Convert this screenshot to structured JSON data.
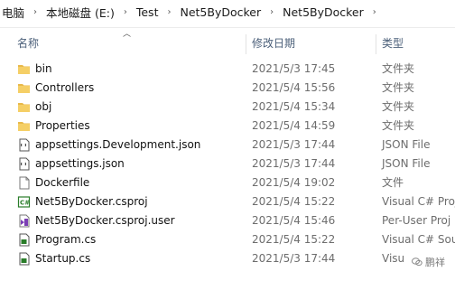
{
  "breadcrumb": {
    "items": [
      "电脑",
      "本地磁盘 (E:)",
      "Test",
      "Net5ByDocker",
      "Net5ByDocker"
    ]
  },
  "columns": {
    "name": "名称",
    "date": "修改日期",
    "type": "类型"
  },
  "rows": [
    {
      "icon": "folder-icon",
      "name": "bin",
      "date": "2021/5/3 17:45",
      "type": "文件夹"
    },
    {
      "icon": "folder-icon",
      "name": "Controllers",
      "date": "2021/5/4 15:56",
      "type": "文件夹"
    },
    {
      "icon": "folder-icon",
      "name": "obj",
      "date": "2021/5/4 15:34",
      "type": "文件夹"
    },
    {
      "icon": "folder-icon",
      "name": "Properties",
      "date": "2021/5/4 14:59",
      "type": "文件夹"
    },
    {
      "icon": "json-file-icon",
      "name": "appsettings.Development.json",
      "date": "2021/5/3 17:44",
      "type": "JSON File"
    },
    {
      "icon": "json-file-icon",
      "name": "appsettings.json",
      "date": "2021/5/3 17:44",
      "type": "JSON File"
    },
    {
      "icon": "generic-file-icon",
      "name": "Dockerfile",
      "date": "2021/5/4 19:02",
      "type": "文件"
    },
    {
      "icon": "csharp-project-icon",
      "name": "Net5ByDocker.csproj",
      "date": "2021/5/4 15:22",
      "type": "Visual C# Proj"
    },
    {
      "icon": "vs-user-file-icon",
      "name": "Net5ByDocker.csproj.user",
      "date": "2021/5/4 15:46",
      "type": "Per-User Proj"
    },
    {
      "icon": "csharp-file-icon",
      "name": "Program.cs",
      "date": "2021/5/4 15:22",
      "type": "Visual C# Sou"
    },
    {
      "icon": "csharp-file-icon",
      "name": "Startup.cs",
      "date": "2021/5/3 17:44",
      "type": "Visu"
    }
  ],
  "watermark": {
    "text": "鹏祥",
    "icon": "wechat-logo"
  },
  "colors": {
    "folder": "#e8b94a",
    "folder_dark": "#d9a53a",
    "header_text": "#4c607a",
    "secondary_text": "#6d6d6d",
    "csharp_green": "#2a7d2a",
    "vs_purple": "#7b3fb5"
  }
}
